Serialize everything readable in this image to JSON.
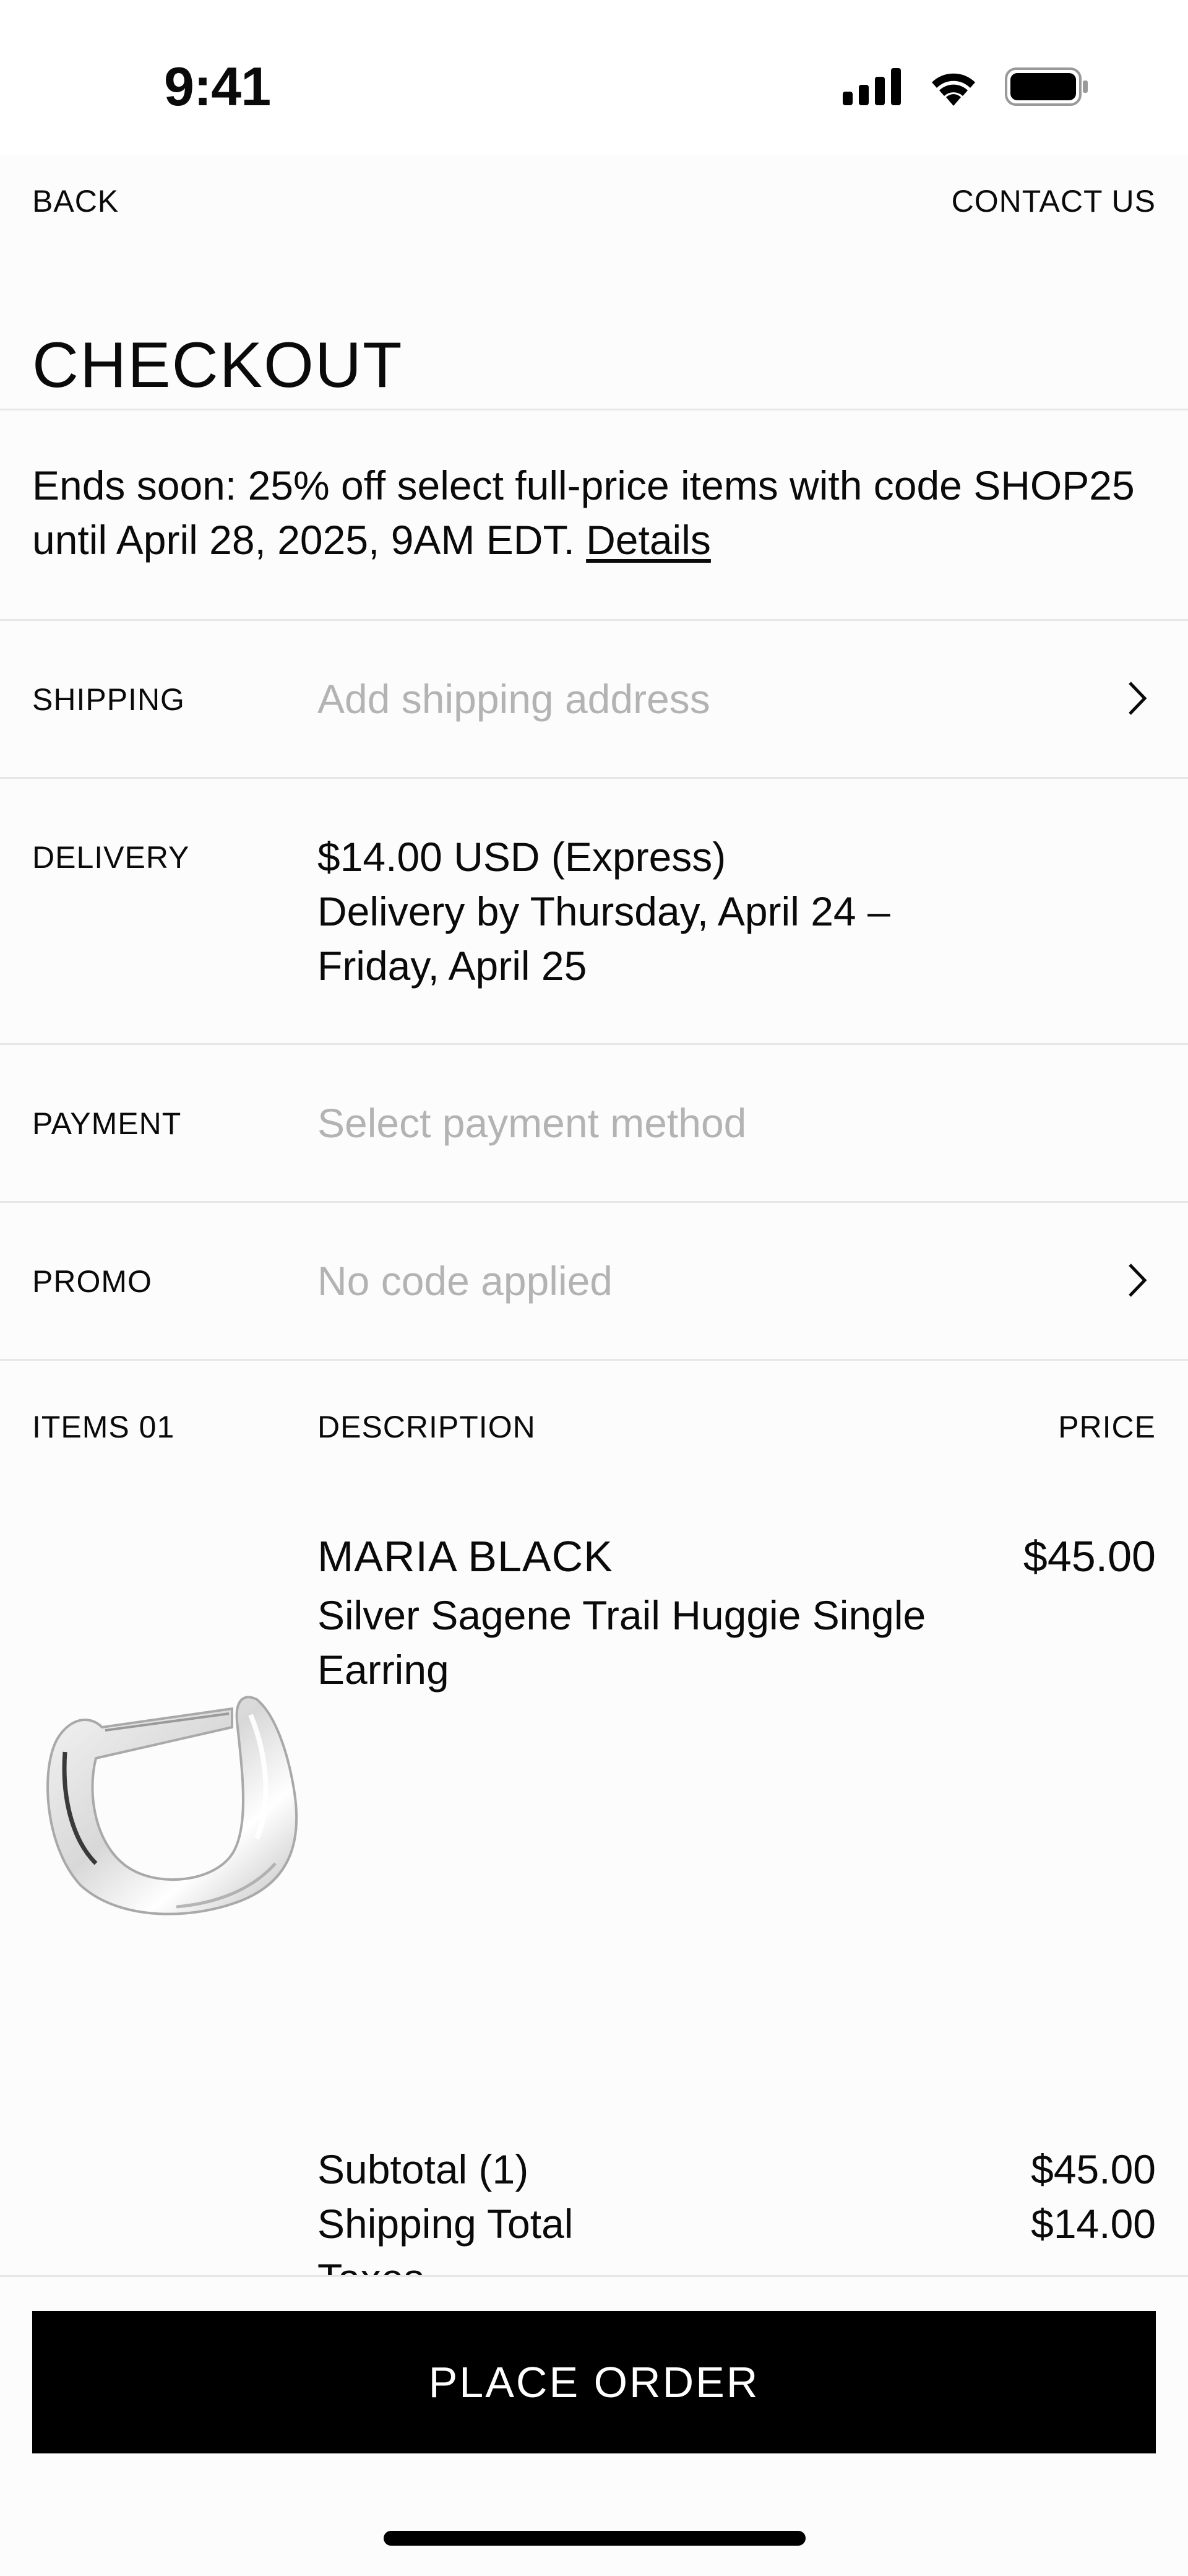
{
  "status_bar": {
    "time": "9:41",
    "icons": [
      "cellular-signal-icon",
      "wifi-icon",
      "battery-icon"
    ]
  },
  "nav": {
    "back_label": "BACK",
    "contact_label": "CONTACT US"
  },
  "page_title": "CHECKOUT",
  "promo_banner": {
    "text": "Ends soon: 25% off select full-price items with code SHOP25 until April 28, 2025, 9AM EDT.",
    "link_label": "Details"
  },
  "shipping": {
    "label": "SHIPPING",
    "placeholder": "Add shipping address"
  },
  "delivery": {
    "label": "DELIVERY",
    "price_line": "$14.00 USD (Express)",
    "date_line": "Delivery by Thursday, April 24 – Friday, April 25"
  },
  "payment": {
    "label": "PAYMENT",
    "placeholder": "Select payment method"
  },
  "promo": {
    "label": "PROMO",
    "placeholder": "No code applied"
  },
  "items_header": {
    "items_label": "ITEMS 01",
    "description_label": "DESCRIPTION",
    "price_label": "PRICE"
  },
  "items": [
    {
      "brand": "MARIA BLACK",
      "name": "Silver Sagene Trail Huggie Single Earring",
      "price": "$45.00"
    }
  ],
  "totals": [
    {
      "label": "Subtotal (1)",
      "value": "$45.00"
    },
    {
      "label": "Shipping Total",
      "value": "$14.00"
    },
    {
      "label": "Taxes",
      "value": ""
    }
  ],
  "place_order_label": "PLACE ORDER",
  "colors": {
    "background": "#fcfcfc",
    "text": "#0a0a0a",
    "placeholder": "#b3b3b3",
    "divider": "#e7e7e7",
    "button": "#000000",
    "button_text": "#ffffff"
  }
}
